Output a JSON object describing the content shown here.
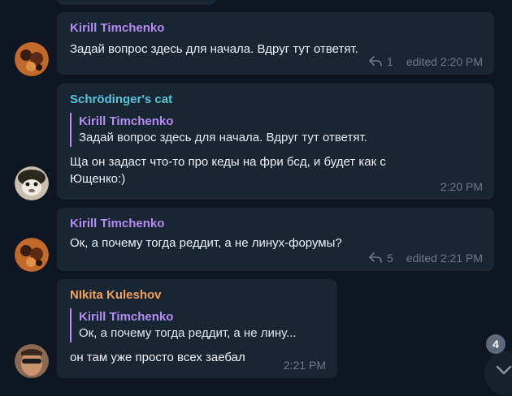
{
  "messages": [
    {
      "sender": "Kirill Timchenko",
      "text": "Задай вопрос здесь для начала. Вдруг тут ответят.",
      "reply_count": "1",
      "time": "edited 2:20 PM"
    },
    {
      "sender": "Schrödinger's cat",
      "quote_sender": "Kirill Timchenko",
      "quote_text": "Задай вопрос здесь для начала. Вдруг тут ответят.",
      "text_line1": "Ща он задаст что-то про кеды на фри бсд, и будет как с",
      "text_line2": "Ющенко:)",
      "time": "2:20 PM"
    },
    {
      "sender": "Kirill Timchenko",
      "text": "Ок, а почему тогда реддит, а не линух-форумы?",
      "reply_count": "5",
      "time": "edited 2:21 PM"
    },
    {
      "sender": "NIkita Kuleshov",
      "quote_sender": "Kirill Timchenko",
      "quote_text": "Ок, а почему тогда реддит, а не лину...",
      "text": "он там уже просто всех заебал",
      "time": "2:21 PM"
    }
  ],
  "scroll_down": {
    "unread_badge": "4"
  },
  "icons": {
    "reply": "reply-arrow-icon",
    "scroll": "chevron-down-icon"
  },
  "colors": {
    "background": "#0e1621",
    "bubble": "#182533",
    "name_purple": "#b48cf2",
    "name_cyan": "#58c4dd",
    "name_orange": "#f5a05a",
    "meta": "#6c7a88"
  }
}
